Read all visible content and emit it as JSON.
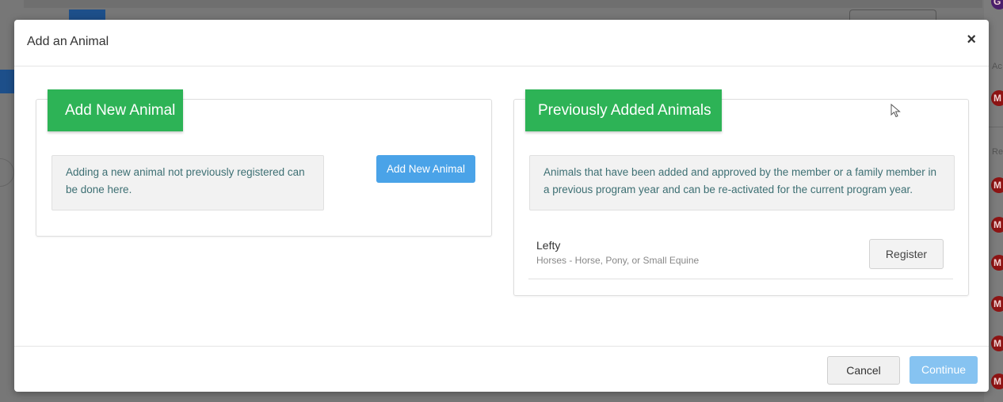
{
  "background": {
    "side_labels": [
      "Ac",
      "Re"
    ],
    "avatar_letters": [
      "G",
      "M",
      "M",
      "M",
      "M",
      "M",
      "M",
      "M"
    ]
  },
  "modal": {
    "title": "Add an Animal",
    "close_icon": "×"
  },
  "left_card": {
    "ribbon_label": "Add New Animal",
    "info_text": "Adding a new animal not previously registered can be done here.",
    "button_label": "Add New Animal"
  },
  "right_card": {
    "ribbon_label": "Previously Added Animals",
    "info_text": "Animals that have been added and approved by the member or a family member in a previous program year and can be re-activated for the current program year.",
    "animals": [
      {
        "name": "Lefty",
        "type": "Horses - Horse, Pony, or Small Equine",
        "action_label": "Register"
      }
    ]
  },
  "footer": {
    "cancel_label": "Cancel",
    "continue_label": "Continue"
  },
  "colors": {
    "ribbon_green": "#2db356",
    "primary_blue": "#4aa3e8",
    "disabled_blue": "#86c3f1",
    "info_text": "#3d6f73",
    "avatar_red": "#8e1414"
  },
  "icons": [
    "close-icon",
    "mouse-pointer-icon"
  ]
}
